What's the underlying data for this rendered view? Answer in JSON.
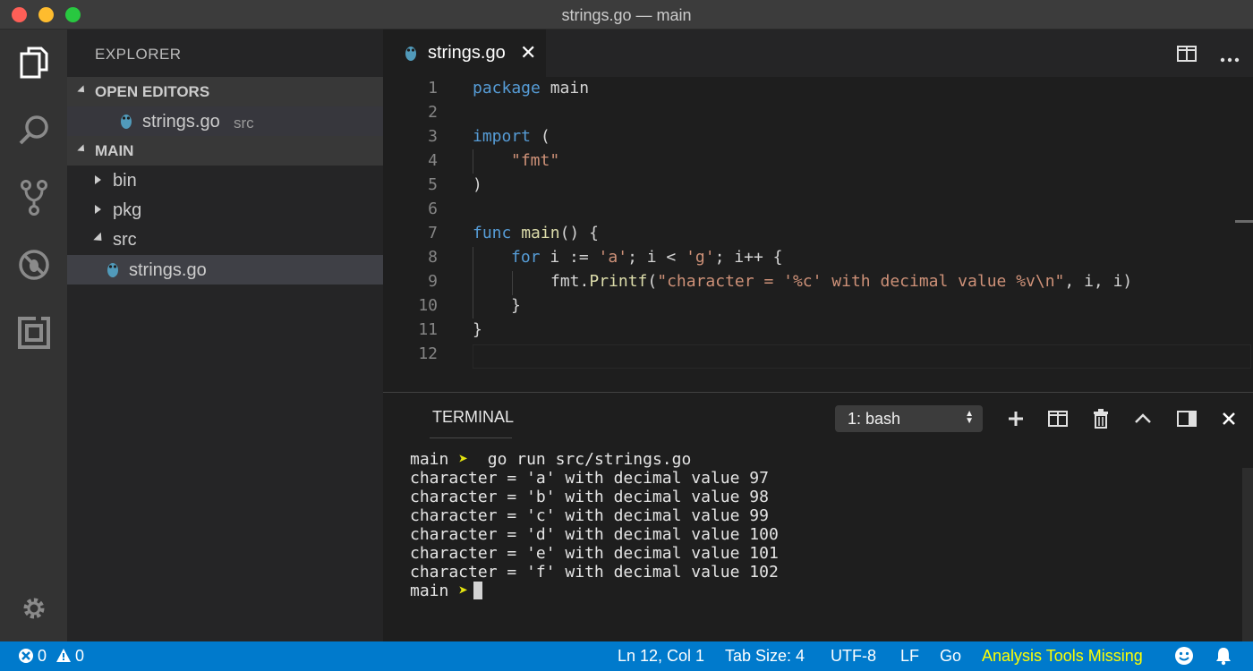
{
  "window": {
    "title": "strings.go — main"
  },
  "sidebar": {
    "title": "EXPLORER",
    "open_editors": {
      "label": "OPEN EDITORS",
      "items": [
        {
          "name": "strings.go",
          "folder": "src"
        }
      ]
    },
    "workspace": {
      "label": "MAIN",
      "tree": [
        {
          "name": "bin",
          "expanded": false
        },
        {
          "name": "pkg",
          "expanded": false
        },
        {
          "name": "src",
          "expanded": true
        },
        {
          "name": "strings.go",
          "selected": true
        }
      ]
    }
  },
  "activity_bar": {
    "icons": [
      "files-icon",
      "search-icon",
      "source-control-icon",
      "debug-icon",
      "extensions-icon",
      "gear-icon"
    ]
  },
  "editor": {
    "tab": {
      "label": "strings.go",
      "close": "✕"
    },
    "line_numbers": [
      "1",
      "2",
      "3",
      "4",
      "5",
      "6",
      "7",
      "8",
      "9",
      "10",
      "11",
      "12"
    ],
    "code": {
      "l1_kw": "package",
      "l1_rest": " main",
      "l3_kw": "import",
      "l3_rest": " (",
      "l4_str": "\"fmt\"",
      "l5": ")",
      "l7_kw": "func",
      "l7_fn": "main",
      "l7_rest": "() {",
      "l8_kw": "for",
      "l8_a": " i := ",
      "l8_s1": "'a'",
      "l8_b": "; i < ",
      "l8_s2": "'g'",
      "l8_c": "; i++ {",
      "l9_a": "fmt.",
      "l9_fn": "Printf",
      "l9_b": "(",
      "l9_str": "\"character = '%c' with decimal value %v\\n\"",
      "l9_c": ", i, i)",
      "l10": "}",
      "l11": "}"
    }
  },
  "panel": {
    "title": "TERMINAL",
    "selector": "1: bash",
    "prompt_dir": "main",
    "prompt_glyph": "➤",
    "command": "go run src/strings.go",
    "output": [
      "character = 'a' with decimal value 97",
      "character = 'b' with decimal value 98",
      "character = 'c' with decimal value 99",
      "character = 'd' with decimal value 100",
      "character = 'e' with decimal value 101",
      "character = 'f' with decimal value 102"
    ]
  },
  "statusbar": {
    "errors": "0",
    "warnings": "0",
    "position": "Ln 12, Col 1",
    "tab_size": "Tab Size: 4",
    "encoding": "UTF-8",
    "eol": "LF",
    "language": "Go",
    "analysis": "Analysis Tools Missing"
  },
  "colors": {
    "statusbar": "#007acc",
    "keyword": "#569cd6",
    "string": "#ce9178",
    "function": "#dcdcaa",
    "warning_text": "#ffff00",
    "prompt_arrow": "#e5e510"
  }
}
